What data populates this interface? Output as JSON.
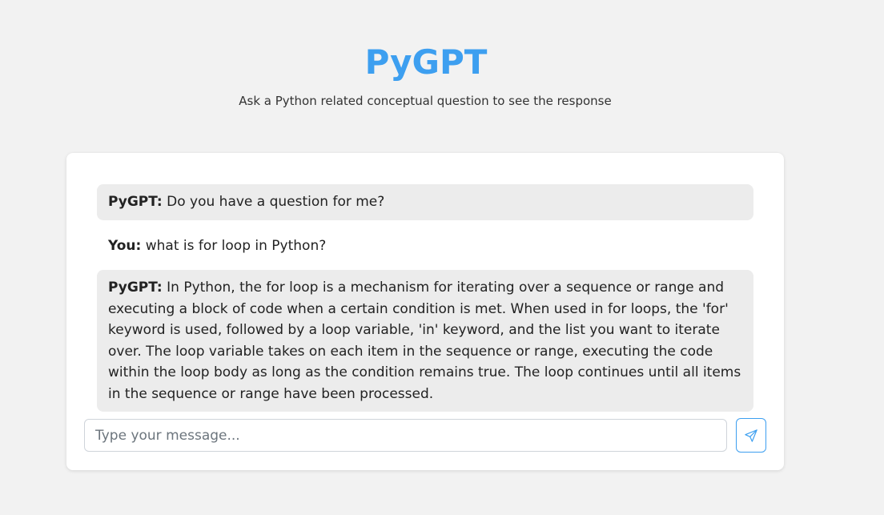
{
  "header": {
    "title": "PyGPT",
    "subtitle": "Ask a Python related conceptual question to see the response"
  },
  "chat": {
    "messages": [
      {
        "role": "bot",
        "speaker": "PyGPT:",
        "text": "Do you have a question for me?"
      },
      {
        "role": "user",
        "speaker": "You:",
        "text": "what is for loop in Python?"
      },
      {
        "role": "bot",
        "speaker": "PyGPT:",
        "text": "In Python, the for loop is a mechanism for iterating over a sequence or range and executing a block of code when a certain condition is met. When used in for loops, the 'for' keyword is used, followed by a loop variable, 'in' keyword, and the list you want to iterate over. The loop variable takes on each item in the sequence or range, executing the code within the loop body as long as the condition remains true. The loop continues until all items in the sequence or range have been processed."
      }
    ]
  },
  "composer": {
    "placeholder": "Type your message...",
    "value": "",
    "send_icon": "send-icon"
  },
  "colors": {
    "accent": "#3d9ff0",
    "background": "#f2f2f2",
    "bot_bubble": "#ececec",
    "card": "#ffffff"
  }
}
